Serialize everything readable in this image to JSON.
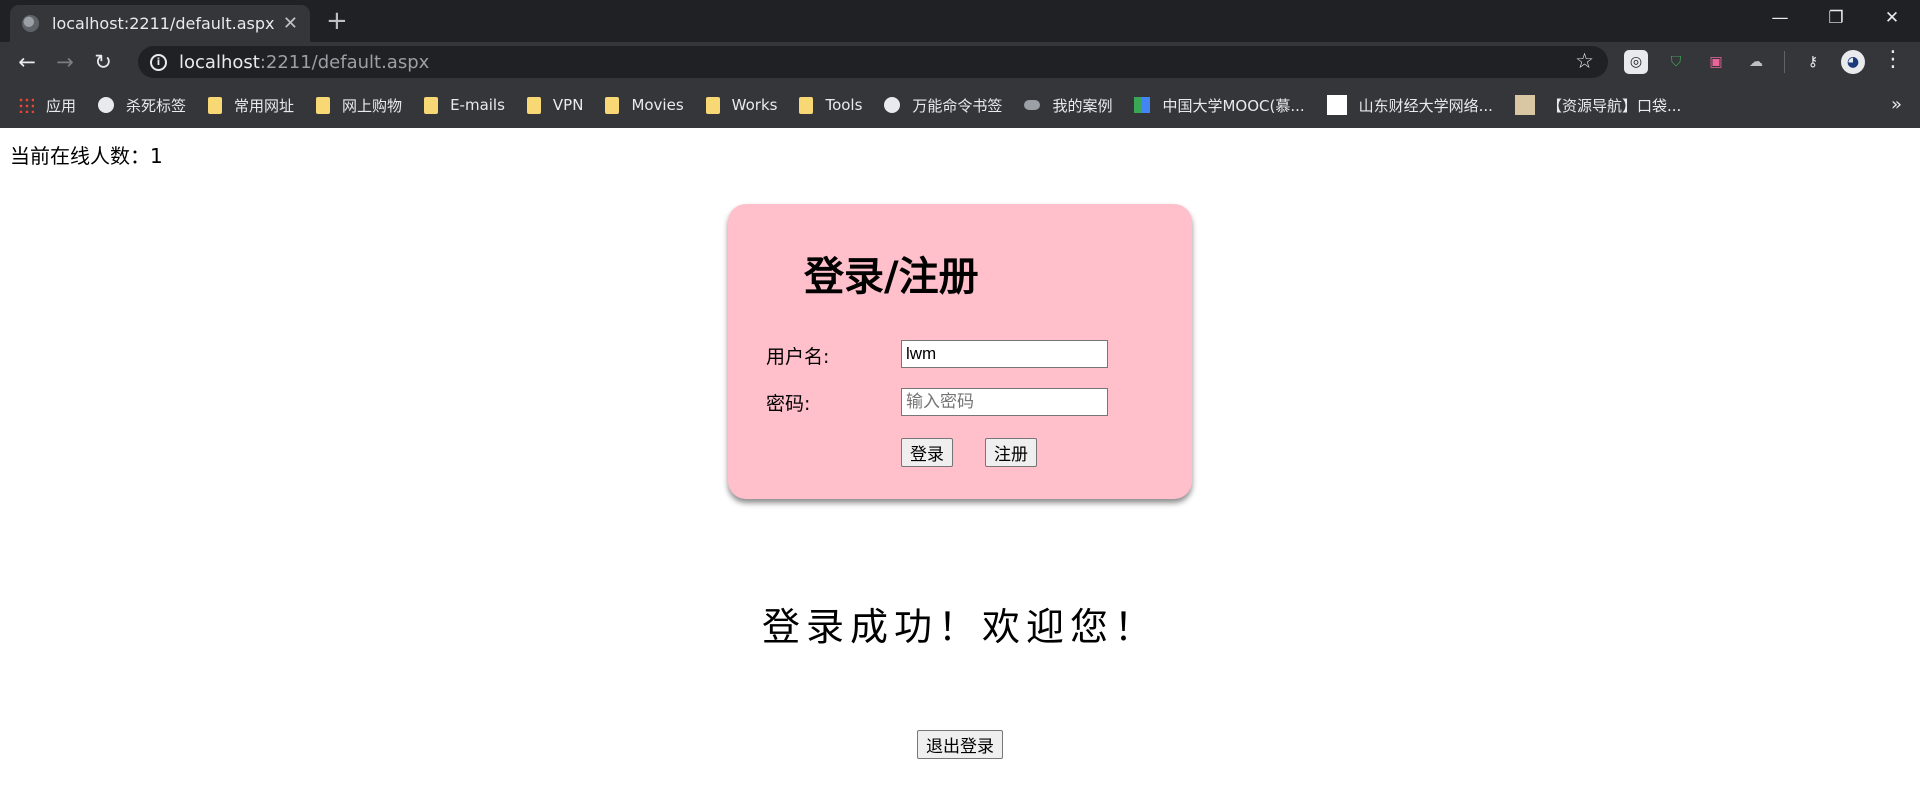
{
  "browser": {
    "tab_title": "localhost:2211/default.aspx",
    "tab_close": "✕",
    "new_tab": "+",
    "url_host": "localhost",
    "url_rest": ":2211/default.aspx",
    "window_controls": {
      "minimize": "—",
      "restore": "❐",
      "close": "✕"
    }
  },
  "bookmarks": [
    {
      "label": "应用",
      "icon": "apps-icon"
    },
    {
      "label": "杀死标签",
      "icon": "globe-icon"
    },
    {
      "label": "常用网址",
      "icon": "folder-icon"
    },
    {
      "label": "网上购物",
      "icon": "folder-icon"
    },
    {
      "label": "E-mails",
      "icon": "folder-icon"
    },
    {
      "label": "VPN",
      "icon": "folder-icon"
    },
    {
      "label": "Movies",
      "icon": "folder-icon"
    },
    {
      "label": "Works",
      "icon": "folder-icon"
    },
    {
      "label": "Tools",
      "icon": "folder-icon"
    },
    {
      "label": "万能命令书签",
      "icon": "globe-icon"
    },
    {
      "label": "我的案例",
      "icon": "cloud-icon"
    },
    {
      "label": "中国大学MOOC(慕...",
      "icon": "mooc-icon"
    },
    {
      "label": "山东财经大学网络...",
      "icon": "page-icon"
    },
    {
      "label": "【资源导航】口袋...",
      "icon": "image-icon"
    }
  ],
  "bookmarks_more": "»",
  "page": {
    "online_count": "当前在线人数：1",
    "login": {
      "title": "登录/注册",
      "username_label": "用户名:",
      "username_value": "lwm",
      "password_label": "密码:",
      "password_placeholder": "输入密码",
      "login_button": "登录",
      "register_button": "注册"
    },
    "success_message": "登录成功！欢迎您！",
    "logout_button": "退出登录"
  }
}
